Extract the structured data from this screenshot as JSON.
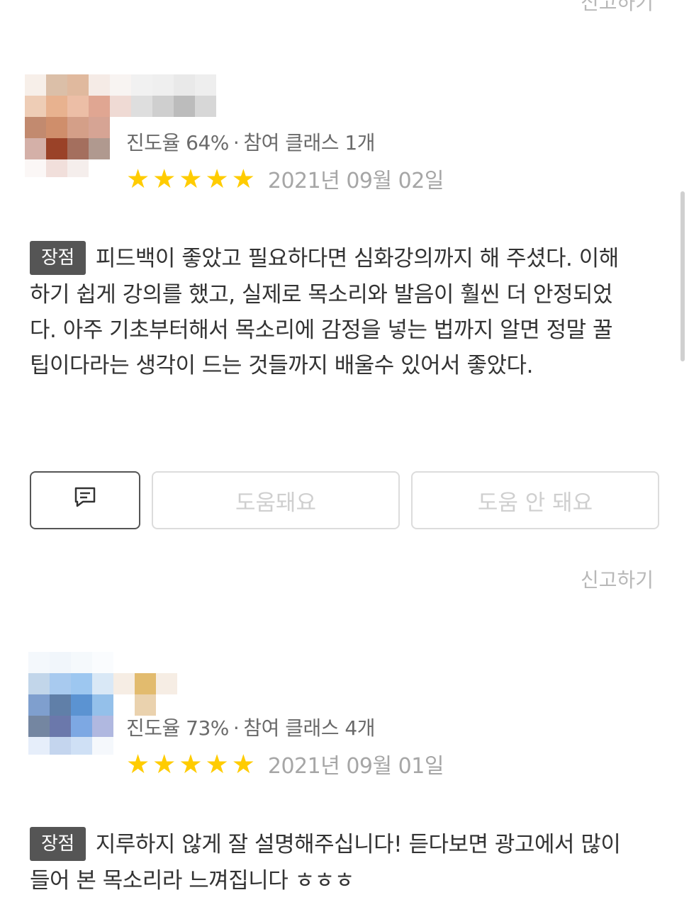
{
  "top_report_label": "신고하기",
  "colors": {
    "star": "#ffcc00",
    "tag_bg": "#555555",
    "muted": "#a6a6a6"
  },
  "reviews": [
    {
      "progress_label": "진도율 64%",
      "classes_label": "참여 클래스 1개",
      "rating": 5,
      "stars": "★★★★★",
      "date": "2021년 09월 02일",
      "tag": "장점",
      "text": "피드백이 좋았고 필요하다면 심화강의까지 해 주셨다. 이해하기 쉽게 강의를 했고, 실제로 목소리와 발음이 훨씬 더 안정되었다. 아주 기초부터해서 목소리에 감정을 넣는 법까지 알면 정말 꿀팁이다라는 생각이 드는 것들까지 배울수 있어서 좋았다.",
      "comment_icon": "comment-icon",
      "helpful_label": "도움돼요",
      "not_helpful_label": "도움 안 돼요",
      "report_label": "신고하기"
    },
    {
      "progress_label": "진도율 73%",
      "classes_label": "참여 클래스 4개",
      "rating": 5,
      "stars": "★★★★★",
      "date": "2021년 09월 01일",
      "tag": "장점",
      "text": "지루하지 않게 잘 설명해주십니다! 듣다보면 광고에서 많이 들어 본 목소리라 느껴집니다 ㅎㅎㅎ"
    }
  ]
}
